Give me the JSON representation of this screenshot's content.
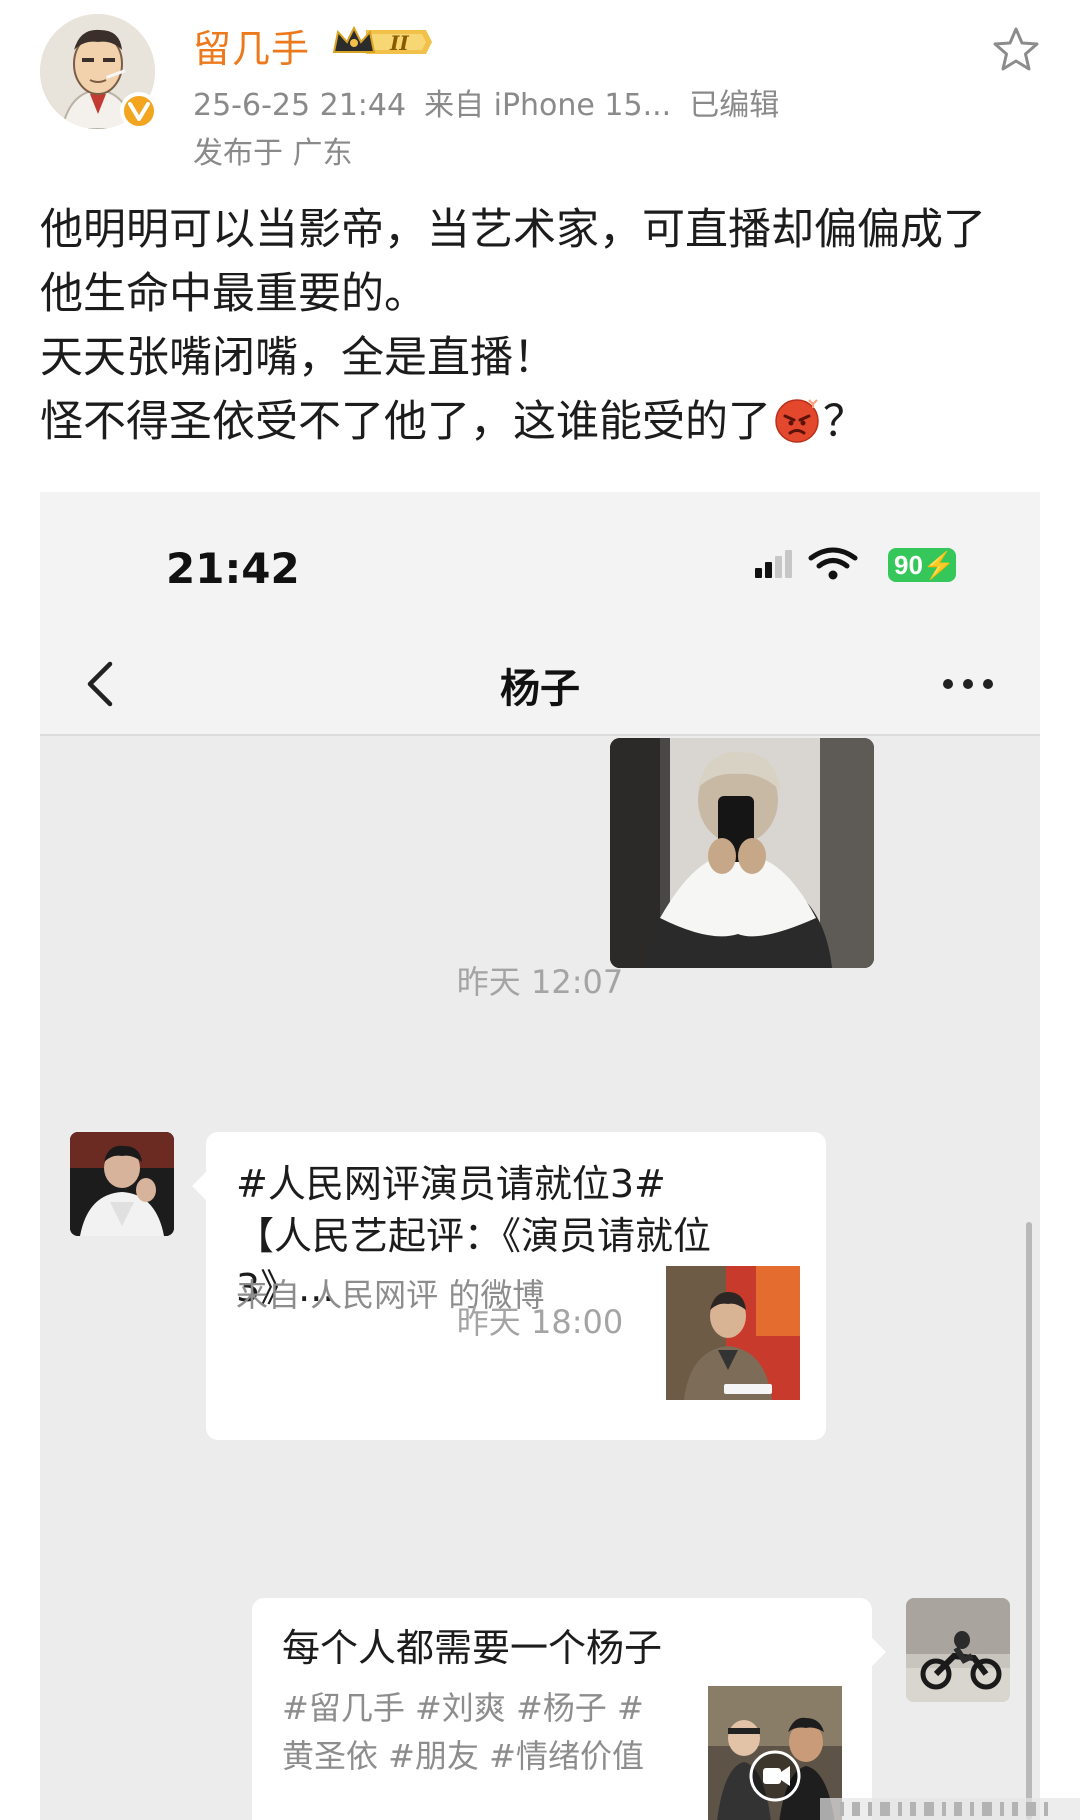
{
  "post": {
    "author": "留几手",
    "level_badge": "II",
    "time": "25-6-25 21:44",
    "source": "来自 iPhone 15...",
    "edited": "已编辑",
    "location": "发布于 广东",
    "text_lines": [
      "他明明可以当影帝，当艺术家，可直播却偏偏成了",
      "他生命中最重要的。",
      "天天张嘴闭嘴，全是直播！"
    ],
    "last_line_before_emoji": "怪不得圣依受不了他了，这谁能受的了",
    "last_line_after_emoji": "？",
    "emoji": "angry-face"
  },
  "screenshot": {
    "clock": "21:42",
    "battery": "90",
    "chat_title": "杨子",
    "time_1": "昨天 12:07",
    "card1_title": "#人民网评演员请就位3#【人民艺起评：《演员请就位 3》...",
    "card1_source": "来自 人民网评 的微博",
    "time_2": "昨天 18:00",
    "card2_title": "每个人都需要一个杨子",
    "card2_tags": "#留几手 #刘爽 #杨子 #黄圣依 #朋友 #情绪价值"
  },
  "colors": {
    "author": "#ec7a1d",
    "meta": "#8a8a8a",
    "chat_bg": "#ececec",
    "battery": "#35c759"
  }
}
